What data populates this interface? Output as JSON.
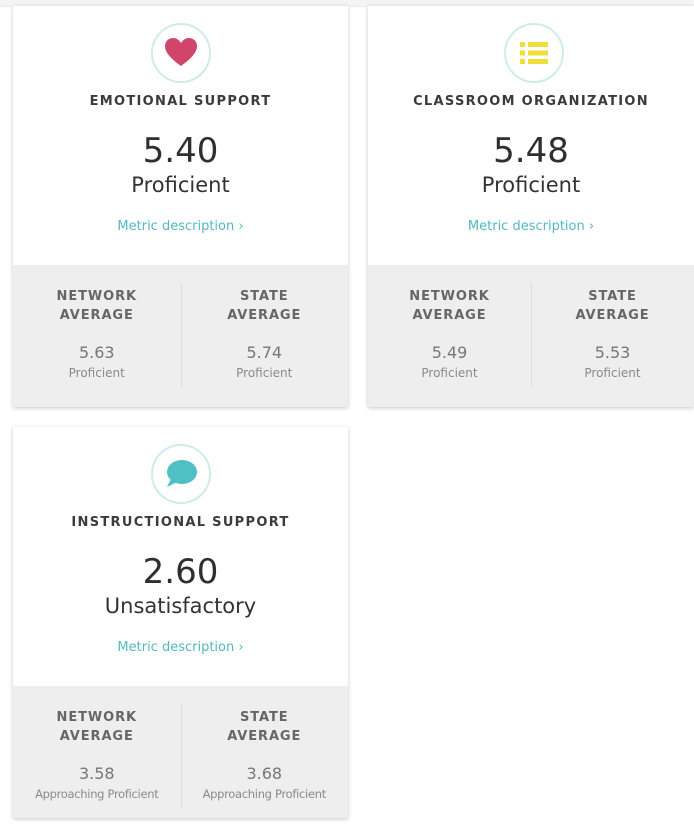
{
  "cards": [
    {
      "icon": "heart-icon",
      "icon_color": "#d1456b",
      "title": "EMOTIONAL SUPPORT",
      "score": "5.40",
      "level": "Proficient",
      "link": "Metric description ›",
      "network": {
        "label_line1": "NETWORK",
        "label_line2": "AVERAGE",
        "value": "5.63",
        "level": "Proficient"
      },
      "state": {
        "label_line1": "STATE",
        "label_line2": "AVERAGE",
        "value": "5.74",
        "level": "Proficient"
      }
    },
    {
      "icon": "list-icon",
      "icon_color": "#f0de3a",
      "title": "CLASSROOM ORGANIZATION",
      "score": "5.48",
      "level": "Proficient",
      "link": "Metric description ›",
      "network": {
        "label_line1": "NETWORK",
        "label_line2": "AVERAGE",
        "value": "5.49",
        "level": "Proficient"
      },
      "state": {
        "label_line1": "STATE",
        "label_line2": "AVERAGE",
        "value": "5.53",
        "level": "Proficient"
      }
    },
    {
      "icon": "speech-bubble-icon",
      "icon_color": "#4fc1c4",
      "title": "INSTRUCTIONAL SUPPORT",
      "score": "2.60",
      "level": "Unsatisfactory",
      "link": "Metric description ›",
      "network": {
        "label_line1": "NETWORK",
        "label_line2": "AVERAGE",
        "value": "3.58",
        "level": "Approaching Proficient"
      },
      "state": {
        "label_line1": "STATE",
        "label_line2": "AVERAGE",
        "value": "3.68",
        "level": "Approaching Proficient"
      }
    }
  ]
}
